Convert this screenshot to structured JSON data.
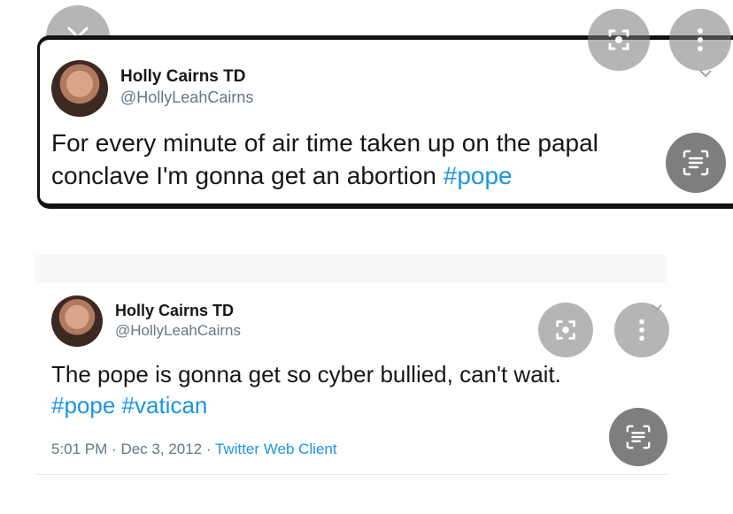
{
  "tweets": [
    {
      "name": "Holly Cairns TD",
      "handle": "@HollyLeahCairns",
      "text_line1": "For every minute of air time taken up on the papal",
      "text_line2_before": "conclave I'm gonna get an abortion ",
      "hashtag": "#pope"
    },
    {
      "name": "Holly Cairns TD",
      "handle": "@HollyLeahCairns",
      "text_line1": "The pope is gonna get so cyber bullied, can't wait.",
      "hashtags": "#pope #vatican",
      "time": "5:01 PM",
      "date": "Dec 3, 2012",
      "client": "Twitter Web Client",
      "sep": "·"
    }
  ],
  "overlay_icons": {
    "close": "close-icon",
    "lens": "lens-icon",
    "more": "more-icon",
    "text_scan": "text-scan-icon",
    "chevron": "chevron-down-icon"
  }
}
